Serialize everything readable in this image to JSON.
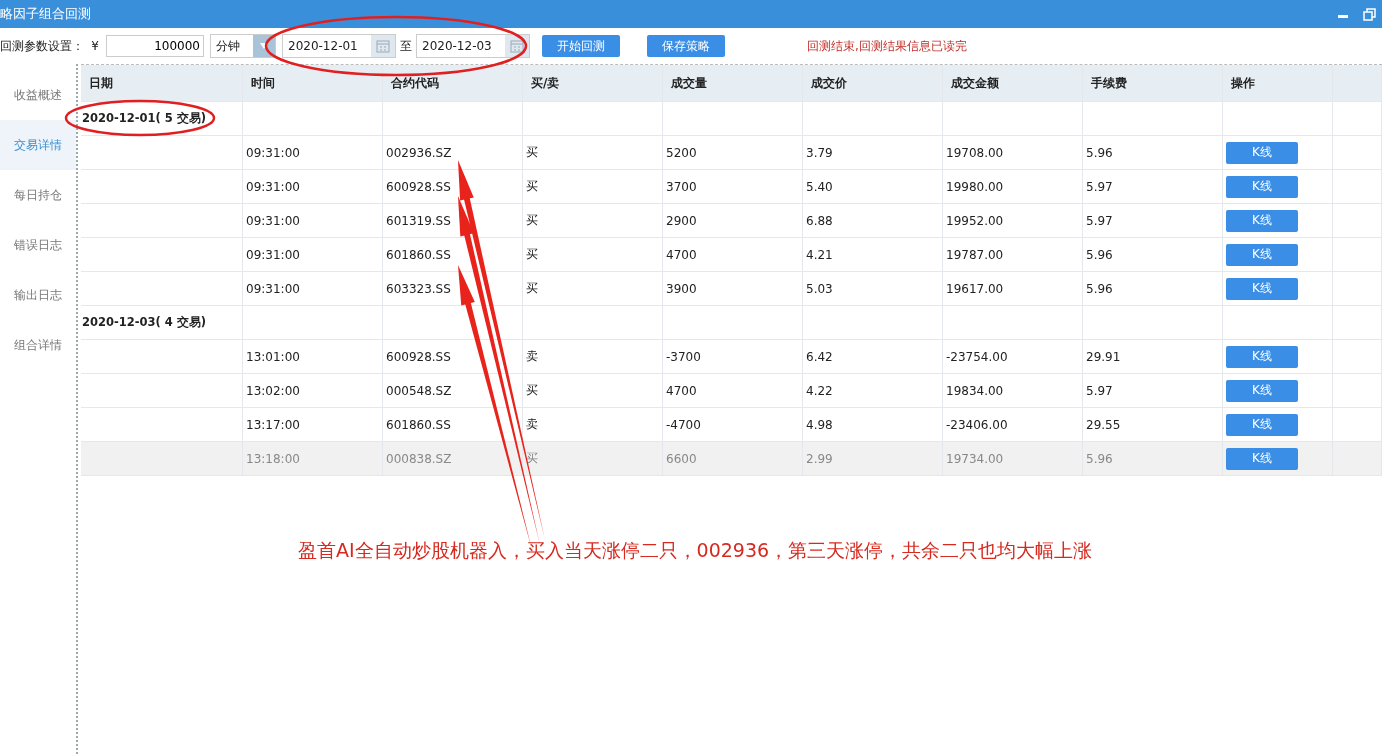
{
  "window": {
    "title": "略因子组合回测"
  },
  "toolbar": {
    "label": "回测参数设置：",
    "currency": "¥",
    "capital": "100000",
    "period": "分钟",
    "start_date": "2020-12-01",
    "to_label": "至",
    "end_date": "2020-12-03",
    "buttons": [
      "开始回测",
      "保存策略"
    ],
    "status": "回测结束,回测结果信息已读完"
  },
  "sidebar": {
    "items": [
      {
        "label": "收益概述",
        "selected": false
      },
      {
        "label": "交易详情",
        "selected": true
      },
      {
        "label": "每日持仓",
        "selected": false
      },
      {
        "label": "错误日志",
        "selected": false
      },
      {
        "label": "输出日志",
        "selected": false
      },
      {
        "label": "组合详情",
        "selected": false
      }
    ]
  },
  "table": {
    "columns": [
      "日期",
      "时间",
      "合约代码",
      "买/卖",
      "成交量",
      "成交价",
      "成交金额",
      "手续费",
      "操作"
    ],
    "rows": [
      {
        "kind": "group",
        "date": "2020-12-01( 5 交易)"
      },
      {
        "kind": "trade",
        "selected": false,
        "cells": [
          "09:31:00",
          "002936.SZ",
          "买",
          "5200",
          "3.79",
          "19708.00",
          "5.96"
        ],
        "action": "K线"
      },
      {
        "kind": "trade",
        "selected": false,
        "cells": [
          "09:31:00",
          "600928.SS",
          "买",
          "3700",
          "5.40",
          "19980.00",
          "5.97"
        ],
        "action": "K线"
      },
      {
        "kind": "trade",
        "selected": false,
        "cells": [
          "09:31:00",
          "601319.SS",
          "买",
          "2900",
          "6.88",
          "19952.00",
          "5.97"
        ],
        "action": "K线"
      },
      {
        "kind": "trade",
        "selected": false,
        "cells": [
          "09:31:00",
          "601860.SS",
          "买",
          "4700",
          "4.21",
          "19787.00",
          "5.96"
        ],
        "action": "K线"
      },
      {
        "kind": "trade",
        "selected": false,
        "cells": [
          "09:31:00",
          "603323.SS",
          "买",
          "3900",
          "5.03",
          "19617.00",
          "5.96"
        ],
        "action": "K线"
      },
      {
        "kind": "group",
        "date": "2020-12-03( 4 交易)"
      },
      {
        "kind": "trade",
        "selected": false,
        "cells": [
          "13:01:00",
          "600928.SS",
          "卖",
          "-3700",
          "6.42",
          "-23754.00",
          "29.91"
        ],
        "action": "K线"
      },
      {
        "kind": "trade",
        "selected": false,
        "cells": [
          "13:02:00",
          "000548.SZ",
          "买",
          "4700",
          "4.22",
          "19834.00",
          "5.97"
        ],
        "action": "K线"
      },
      {
        "kind": "trade",
        "selected": false,
        "cells": [
          "13:17:00",
          "601860.SS",
          "卖",
          "-4700",
          "4.98",
          "-23406.00",
          "29.55"
        ],
        "action": "K线"
      },
      {
        "kind": "trade",
        "selected": true,
        "cells": [
          "13:18:00",
          "000838.SZ",
          "买",
          "6600",
          "2.99",
          "19734.00",
          "5.96"
        ],
        "action": "K线"
      }
    ]
  },
  "annotation": {
    "caption": "盈首AI全自动炒股机器入，买入当天涨停二只，002936，第三天涨停，共余二只也均大幅上涨"
  }
}
